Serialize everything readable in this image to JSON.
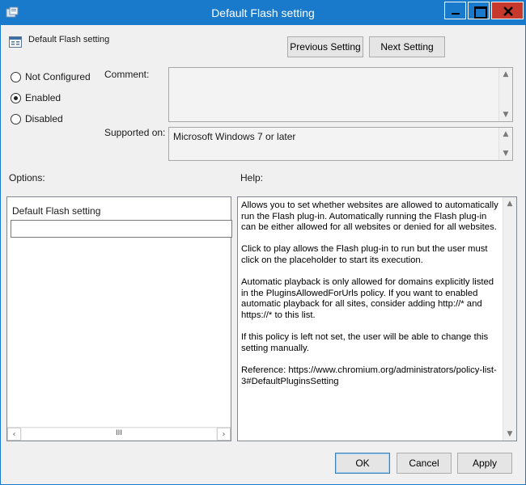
{
  "window": {
    "title": "Default Flash setting"
  },
  "header": {
    "policy_name": "Default Flash setting",
    "previous_label": "Previous Setting",
    "next_label": "Next Setting"
  },
  "state": {
    "options": [
      {
        "label": "Not Configured",
        "checked": false
      },
      {
        "label": "Enabled",
        "checked": true
      },
      {
        "label": "Disabled",
        "checked": false
      }
    ]
  },
  "fields": {
    "comment_label": "Comment:",
    "comment_value": "",
    "supported_label": "Supported on:",
    "supported_value": "Microsoft Windows 7 or later"
  },
  "sections": {
    "options_label": "Options:",
    "help_label": "Help:"
  },
  "options_panel": {
    "setting_label": "Default Flash setting",
    "setting_value": ""
  },
  "help": {
    "paragraphs": [
      "Allows you to set whether websites are allowed to automatically run the Flash plug-in. Automatically running the Flash plug-in can be either allowed for all websites or denied for all websites.",
      "Click to play allows the Flash plug-in to run but the user must click on the placeholder to start its execution.",
      "Automatic playback is only allowed for domains explicitly listed in the PluginsAllowedForUrls policy. If you want to enabled automatic playback for all sites, consider adding http://* and https://* to this list.",
      "If this policy is left not set, the user will be able to change this setting manually.",
      "Reference: https://www.chromium.org/administrators/policy-list-3#DefaultPluginsSetting"
    ]
  },
  "footer": {
    "ok_label": "OK",
    "cancel_label": "Cancel",
    "apply_label": "Apply"
  },
  "icons": {
    "app": "policy-app-icon",
    "header": "policy-setting-icon",
    "minimize": "minimize-icon",
    "maximize": "maximize-icon",
    "close": "close-icon",
    "scroll_thumb": "III"
  },
  "colors": {
    "titlebar": "#1979ca",
    "close_button": "#c7392c",
    "dialog_bg": "#f0f0f0"
  }
}
